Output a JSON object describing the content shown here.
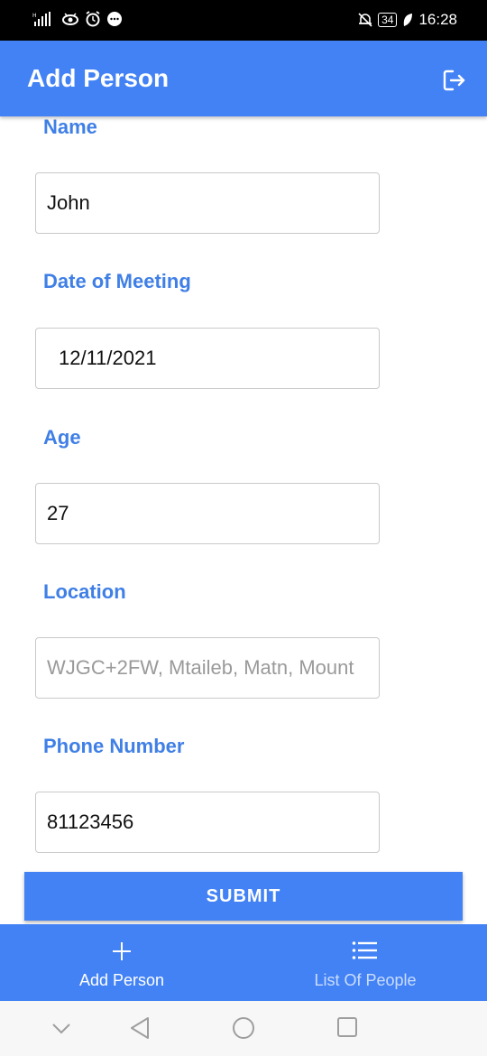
{
  "status_bar": {
    "time": "16:28",
    "battery": "34"
  },
  "app_bar": {
    "title": "Add Person"
  },
  "form": {
    "name": {
      "label": "Name",
      "value": "John"
    },
    "date": {
      "label": "Date of Meeting",
      "value": "12/11/2021"
    },
    "age": {
      "label": "Age",
      "value": "27"
    },
    "location": {
      "label": "Location",
      "placeholder": "WJGC+2FW, Mtaileb, Matn, Mount"
    },
    "phone": {
      "label": "Phone Number",
      "value": "81123456"
    },
    "submit_label": "SUBMIT"
  },
  "bottom_nav": {
    "items": [
      {
        "label": "Add Person",
        "icon": "plus-icon",
        "active": true
      },
      {
        "label": "List Of People",
        "icon": "list-icon",
        "active": false
      }
    ]
  },
  "colors": {
    "primary": "#4282f5",
    "label": "#3f7fe6",
    "status_bar": "#000000"
  }
}
